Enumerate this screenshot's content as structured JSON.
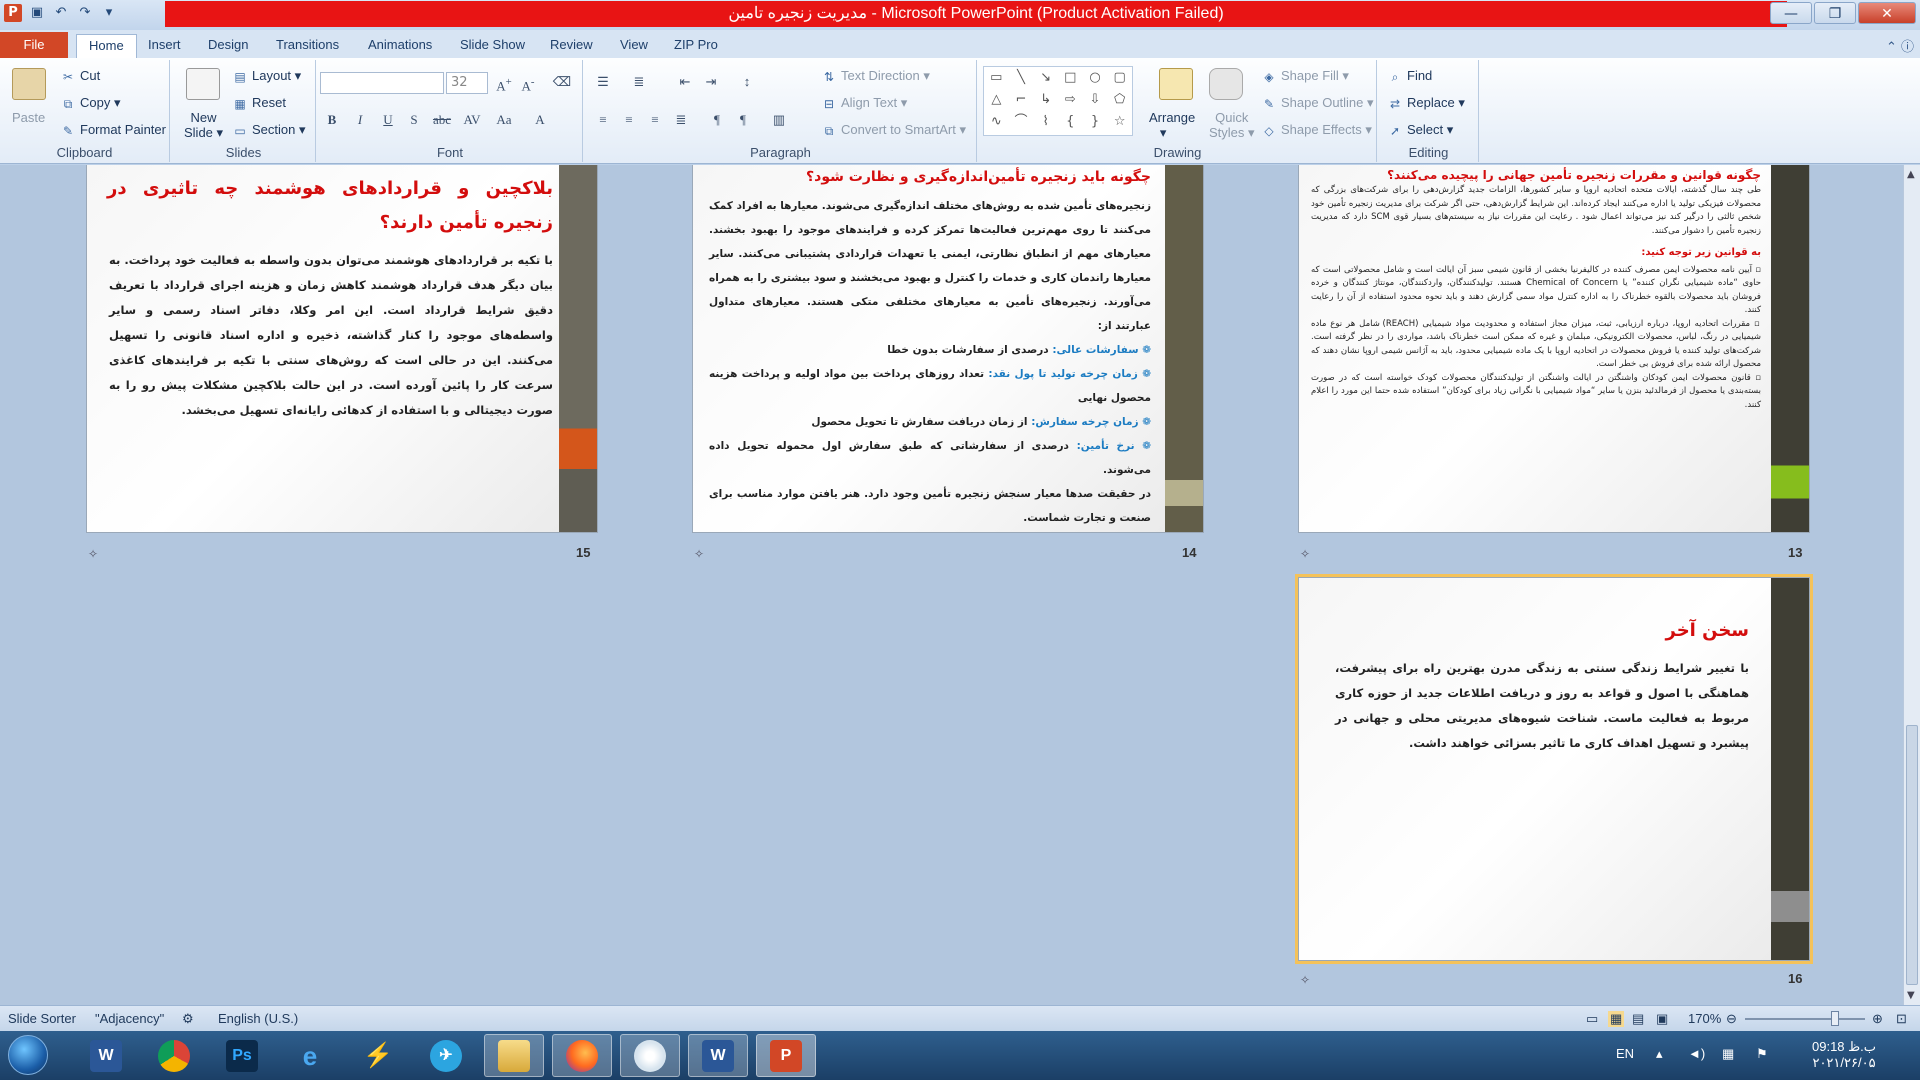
{
  "window": {
    "title": "مدیریت زنجیره تامین - Microsoft PowerPoint (Product Activation Failed)",
    "controls": {
      "minimize": "—",
      "restore": "❐",
      "close": "✕"
    }
  },
  "tabs": [
    "File",
    "Home",
    "Insert",
    "Design",
    "Transitions",
    "Animations",
    "Slide Show",
    "Review",
    "View",
    "ZIP Pro"
  ],
  "ribbon": {
    "clipboard": {
      "paste": "Paste",
      "cut": "Cut",
      "copy": "Copy",
      "format_painter": "Format Painter",
      "label": "Clipboard"
    },
    "slides": {
      "new_slide_1": "New",
      "new_slide_2": "Slide",
      "layout": "Layout",
      "reset": "Reset",
      "section": "Section",
      "label": "Slides"
    },
    "font": {
      "size": "32",
      "label": "Font"
    },
    "paragraph": {
      "text_direction": "Text Direction",
      "align_text": "Align Text",
      "convert_smartart": "Convert to SmartArt",
      "label": "Paragraph"
    },
    "drawing": {
      "arrange": "Arrange",
      "quick_styles_1": "Quick",
      "quick_styles_2": "Styles",
      "shape_fill": "Shape Fill",
      "shape_outline": "Shape Outline",
      "shape_effects": "Shape Effects",
      "label": "Drawing"
    },
    "editing": {
      "find": "Find",
      "replace": "Replace",
      "select": "Select",
      "label": "Editing"
    }
  },
  "slides": {
    "s13": {
      "number": "13",
      "title": "چگونه قوانین و مقررات زنجیره تأمین جهانی را پیچیده می‌کنند؟",
      "para1": "طی چند سال گذشته، ایالات متحده اتحادیه اروپا و سایر کشورها، الزامات جدید گزارش‌دهی را برای شرکت‌های بزرگی که محصولات فیزیکی تولید یا اداره می‌کنند ایجاد کرده‌اند. این شرایط گزارش‌دهی، حتی اگر شرکت برای مدیریت زنجیره تأمین خود شخص ثالثی را درگیر کند نیز می‌تواند اعمال شود . رعایت این مقررات نیاز به سیستم‌های بسیار قوی SCM دارد که مدیریت زنجیره تأمین را دشوار می‌کنند.",
      "subheading": "به قوانین زیر توجه کنید:",
      "bullet1": "▫ آیین نامه محصولات ایمن مصرف کننده در کالیفرنیا بخشی از قانون شیمی سبز آن ایالت است و شامل محصولاتی است که حاوی “ماده شیمیایی نگران کننده” یا Chemical of Concern هستند. تولیدکنندگان، واردکنندگان، مونتاژ کنندگان و خرده فروشان باید محصولات بالقوه خطرناک را به اداره کنترل مواد سمی گزارش دهند و باید نحوه محدود استفاده از آن را رعایت کنند.",
      "bullet2": "▫ مقررات اتحادیه اروپا، درباره ارزیابی، ثبت، میزان مجاز استفاده و محدودیت مواد شیمیایی (REACH) شامل هر نوع ماده شیمیایی در رنگ، لباس، محصولات الکترونیکی، مبلمان و غیره که ممکن است خطرناک باشد، مواردی را در نظر گرفته است. شرکت‌های تولید کننده یا فروش محصولات در اتحادیه اروپا با یک ماده شیمیایی محدود، باید به آژانس شیمی اروپا نشان دهند که محصول ارائه شده برای فروش بی خطر است.",
      "bullet3": "▫ قانون محصولات ایمن کودکان واشنگتن در ایالت واشنگتن از تولیدکنندگان محصولات کودک خواسته است که در صورت بسته‌بندی یا محصول از فرمالدئید بنزن یا سایر “مواد شیمیایی با نگرانی زیاد برای کودکان” استفاده شده حتما این مورد را اعلام کنند."
    },
    "s14": {
      "number": "14",
      "title": "چگونه باید زنجیره تأمین‌اندازه‌گیری و نظارت شود؟",
      "para1": "زنجیره‌های تأمین شده به روش‌های مختلف اندازه‌گیری می‌شوند. معیارها به افراد کمک می‌کنند تا روی مهم‌ترین فعالیت‌ها تمرکز کرده و فرایندهای موجود را بهبود بخشند. معیارهای مهم از انطباق نظارتی، ایمنی یا تعهدات قراردادی پشتیبانی می‌کنند. سایر معیارها راندمان کاری و خدمات را کنترل و بهبود می‌بخشند و سود بیشتری را به همراه می‌آورند. زنجیره‌های تأمین به معیارهای مختلفی متکی هستند. معیارهای متداول عبارتند از:",
      "i1_label": "❁ سفارشات عالی:",
      "i1_text": " درصدی از سفارشات بدون خطا",
      "i2_label": "❁ زمان چرخه تولید تا پول نقد:",
      "i2_text": " تعداد روزهای پرداخت بین مواد اولیه و پرداخت هزینه محصول نهایی",
      "i3_label": "❁ زمان چرخه سفارش:",
      "i3_text": " از زمان دریافت سفارش تا تحویل محصول",
      "i4_label": "❁ نرخ تأمین:",
      "i4_text": " درصدی از سفارشاتی که طبق سفارش اول محموله تحویل داده می‌شوند.",
      "para2": "در حقیقت صدها معیار سنجش زنجیره تأمین وجود دارد. هنر یافتن موارد مناسب برای صنعت و تجارت شماست."
    },
    "s15": {
      "number": "15",
      "title": "بلاکچین و قراردادهای هوشمند چه تاثیری در زنجیره تأمین دارند؟",
      "para1": "با تکیه بر قراردادهای هوشمند می‌توان بدون واسطه به فعالیت خود پرداخت. به بیان دیگر هدف قرارداد هوشمند کاهش زمان و هزینه اجرای قرارداد با تعریف دقیق شرایط قرارداد است. این امر وکلا، دفاتر اسناد رسمی و سایر واسطه‌های موجود را کنار گذاشته، ذخیره و اداره اسناد قانونی را تسهیل می‌کنند. این در حالی است که روش‌های سنتی با تکیه بر فرایندهای کاغذی سرعت کار را پائین آورده است. در این حالت بلاکچین مشکلات پیش رو را به صورت دیجیتالی و با استفاده از کدهائی رایانه‌ای تسهیل می‌بخشد."
    },
    "s16": {
      "number": "16",
      "title": "سخن آخر",
      "para1": "با تغییر شرایط زندگی سنتی به زندگی مدرن بهترین راه برای پیشرفت، هماهنگی با اصول و قواعد به روز و دریافت اطلاعات جدید از حوزه کاری مربوط به فعالیت ماست. شناخت شیوه‌های مدیریتی محلی و جهانی در پیشبرد و تسهیل اهداف کاری ما تاثیر بسزائی خواهند داشت."
    },
    "star": "✧"
  },
  "statusbar": {
    "view": "Slide Sorter",
    "theme": "\"Adjacency\"",
    "language": "English (U.S.)",
    "zoom": "170%",
    "zoom_level": 0.75
  },
  "taskbar": {
    "apps": [
      "W",
      "",
      "Ps",
      "e",
      "⚡",
      "✈",
      "",
      "",
      "",
      "W",
      "P"
    ],
    "lang": "EN",
    "time": "09:18 ب.ظ",
    "date": "۲۰۲۱/۲۶/۰۵"
  },
  "colors": {
    "title_red": "#e81414",
    "heading_red": "#d30d0d",
    "item_blue": "#1c7cc2",
    "file_tab": "#d24726"
  }
}
